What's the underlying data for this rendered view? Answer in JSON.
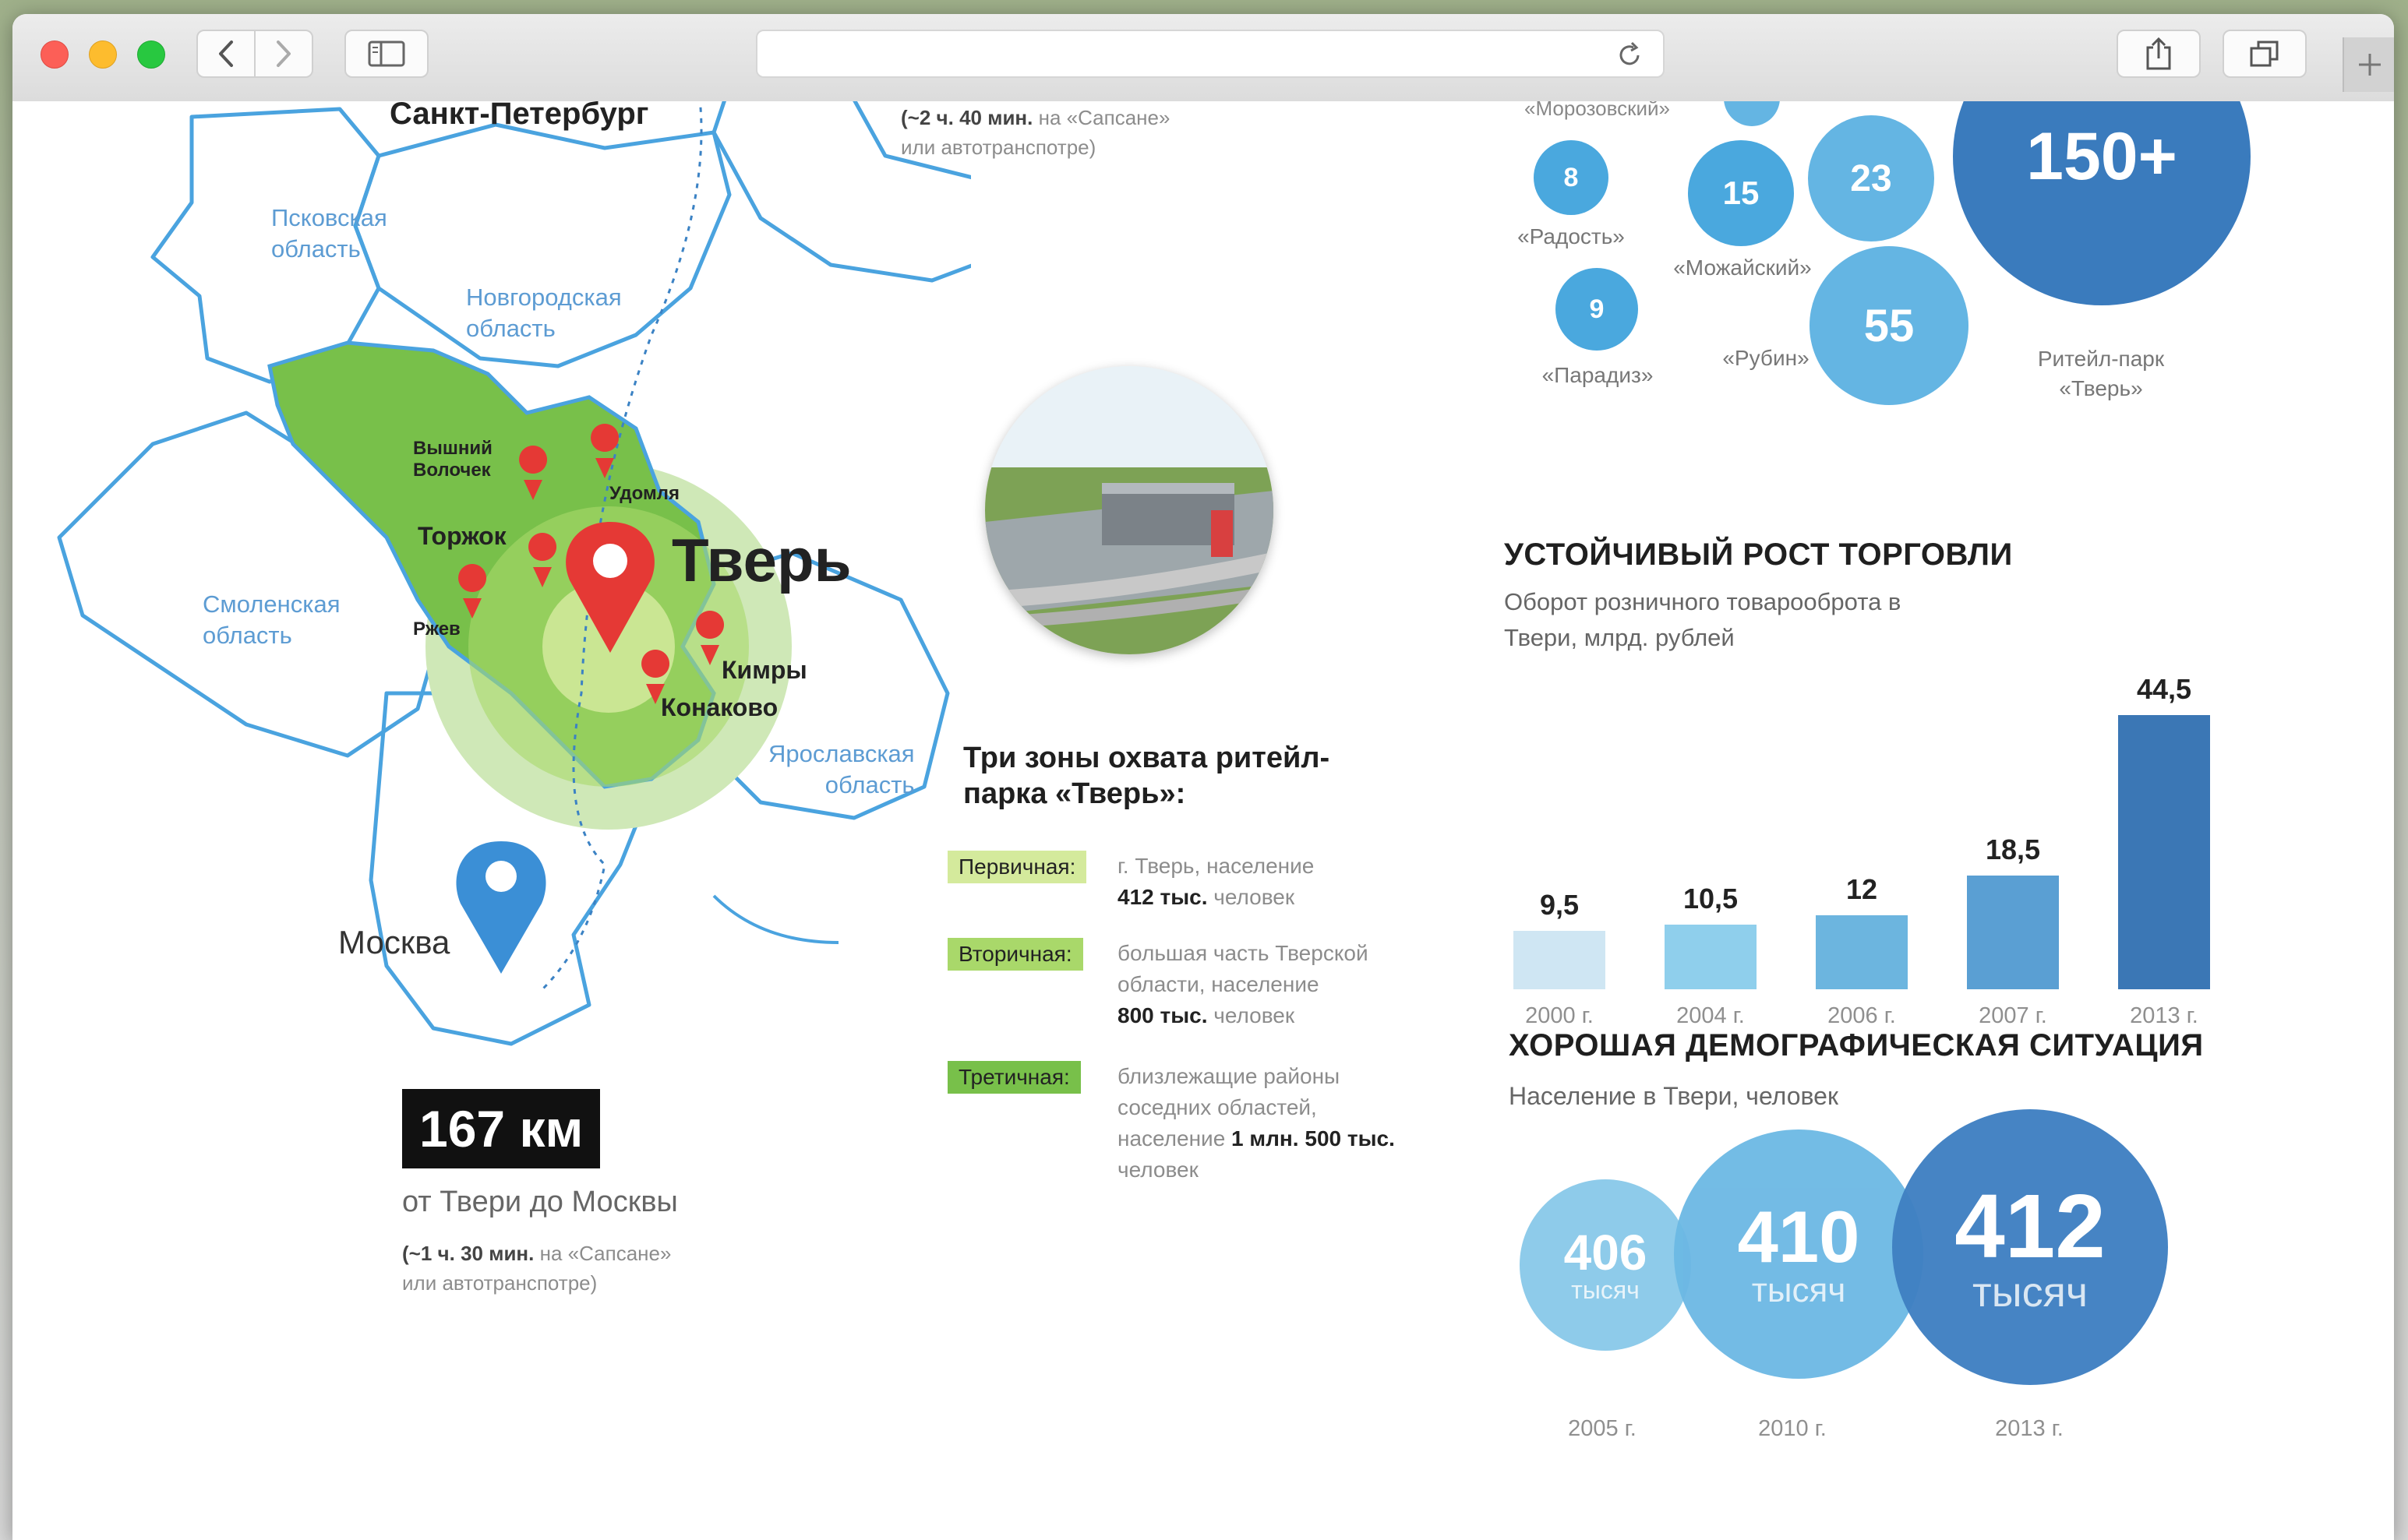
{
  "browser": {
    "nav": {
      "back_icon": "chevron-left-icon",
      "forward_icon": "chevron-right-icon"
    },
    "sidebar_icon": "sidebar-icon",
    "reload_icon": "reload-icon",
    "share_icon": "share-icon",
    "tabs_icon": "tabs-icon",
    "new_tab_icon": "plus-icon"
  },
  "map": {
    "regions": {
      "pskov": "Псковская\nобласть",
      "novgorod": "Новгородская\nобласть",
      "smolensk": "Смоленская\nобласть",
      "yaroslavl": "Ярославская\nобласть"
    },
    "cities": {
      "spb": "Санкт-Петербург",
      "tver": "Тверь",
      "vyshny": "Вышний\nВолочек",
      "udomlya": "Удомля",
      "torzhok": "Торжок",
      "rzhev": "Ржев",
      "kimry": "Кимры",
      "konakovo": "Конаково",
      "moscow": "Москва"
    },
    "spb_travel_time": "(~2 ч. 40 мин.",
    "spb_travel_rest": "на «Сапсане»",
    "spb_travel_line2": "или автотранспотре)"
  },
  "distance": {
    "value": "167 км",
    "caption": "от Твери до Москвы",
    "time_bold": "(~1 ч. 30 мин.",
    "time_rest": "на «Сапсане»",
    "time_line2": "или автотранспотре)"
  },
  "zones": {
    "title_line1": "Три зоны охвата ритейл-",
    "title_line2": "парка «Тверь»:",
    "items": [
      {
        "label": "Первичная:",
        "color": "#d4ea9c",
        "l1": "г. Тверь, население",
        "bold": "412 тыс.",
        "after": "человек"
      },
      {
        "label": "Вторичная:",
        "color": "#a9d86a",
        "l1": "большая часть Тверской",
        "l2": "области, население",
        "bold": "800 тыс.",
        "after": "человек"
      },
      {
        "label": "Третичная:",
        "color": "#78c04a",
        "l1": "близлежащие районы",
        "l2": "соседних областей,",
        "pre": "население",
        "bold": "1 млн. 500 тыс.",
        "l4": "человек"
      }
    ]
  },
  "bubbles": {
    "top_label": "«Морозовский»",
    "items": [
      {
        "value": "8",
        "label": "«Радость»"
      },
      {
        "value": "15",
        "label": "«Можайский»"
      },
      {
        "value": "23",
        "label": ""
      },
      {
        "value": "150+",
        "label": "Ритейл-парк\n«Тверь»"
      },
      {
        "value": "9",
        "label": "«Парадиз»"
      },
      {
        "value": "55",
        "label": "«Рубин»"
      }
    ]
  },
  "growth": {
    "title": "УСТОЙЧИВЫЙ РОСТ ТОРГОВЛИ",
    "subtitle_l1": "Оборот розничного товарооброта в",
    "subtitle_l2": "Твери, млрд. рублей"
  },
  "chart_data": {
    "type": "bar",
    "title": "УСТОЙЧИВЫЙ РОСТ ТОРГОВЛИ",
    "ylabel": "Оборот розничного товарооброта в Твери, млрд. рублей",
    "categories": [
      "2000 г.",
      "2004 г.",
      "2006 г.",
      "2007 г.",
      "2013 г."
    ],
    "values": [
      9.5,
      10.5,
      12,
      18.5,
      44.5
    ],
    "labels": [
      "9,5",
      "10,5",
      "12",
      "18,5",
      "44,5"
    ],
    "colors": [
      "#cfe6f3",
      "#8fcfec",
      "#6cb5df",
      "#5a9fd3",
      "#3b77b5"
    ],
    "ylim": [
      0,
      44.5
    ]
  },
  "demography": {
    "title": "ХОРОШАЯ ДЕМОГРАФИЧЕСКАЯ СИТУАЦИЯ",
    "subtitle": "Население в Твери, человек",
    "items": [
      {
        "value": "406",
        "unit": "тысяч",
        "year": "2005 г."
      },
      {
        "value": "410",
        "unit": "тысяч",
        "year": "2010 г."
      },
      {
        "value": "412",
        "unit": "тысяч",
        "year": "2013 г."
      }
    ]
  }
}
